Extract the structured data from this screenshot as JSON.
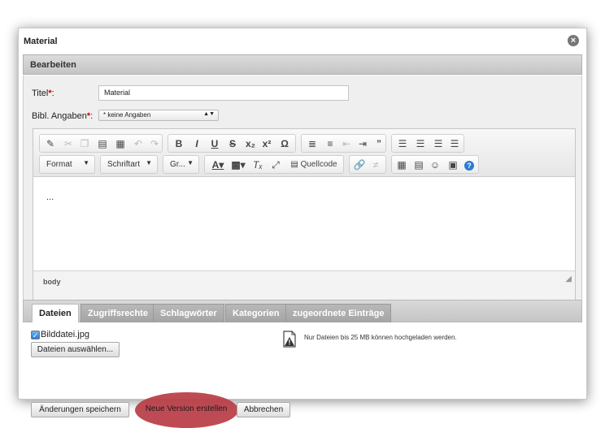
{
  "dialog": {
    "title": "Material",
    "close_icon": "close-icon"
  },
  "section": {
    "title": "Bearbeiten"
  },
  "form": {
    "title_label": "Titel",
    "title_value": "Material",
    "bibl_label": "Bibl. Angaben",
    "required_mark": "*",
    "colon": ":",
    "bibl_value": "* keine Angaben"
  },
  "toolbar": {
    "format_label": "Format",
    "font_label": "Schriftart",
    "size_label": "Gr...",
    "source_label": "Quellcode"
  },
  "editor": {
    "content": "...",
    "path": "body"
  },
  "tabs": [
    {
      "label": "Dateien",
      "active": true
    },
    {
      "label": "Zugriffsrechte",
      "active": false
    },
    {
      "label": "Schlagwörter",
      "active": false
    },
    {
      "label": "Kategorien",
      "active": false
    },
    {
      "label": "zugeordnete Einträge",
      "active": false
    }
  ],
  "files": {
    "file_name": "Bilddatei.jpg",
    "file_checked": true,
    "choose_button": "Dateien auswählen...",
    "upload_info": "Nur Dateien bis 25 MB können hochgeladen werden."
  },
  "actions": {
    "save": "Änderungen speichern",
    "new_version": "Neue Version erstellen",
    "cancel": "Abbrechen"
  },
  "colors": {
    "highlight": "#b83c44",
    "required": "#d40000",
    "help": "#2b7cd3"
  }
}
